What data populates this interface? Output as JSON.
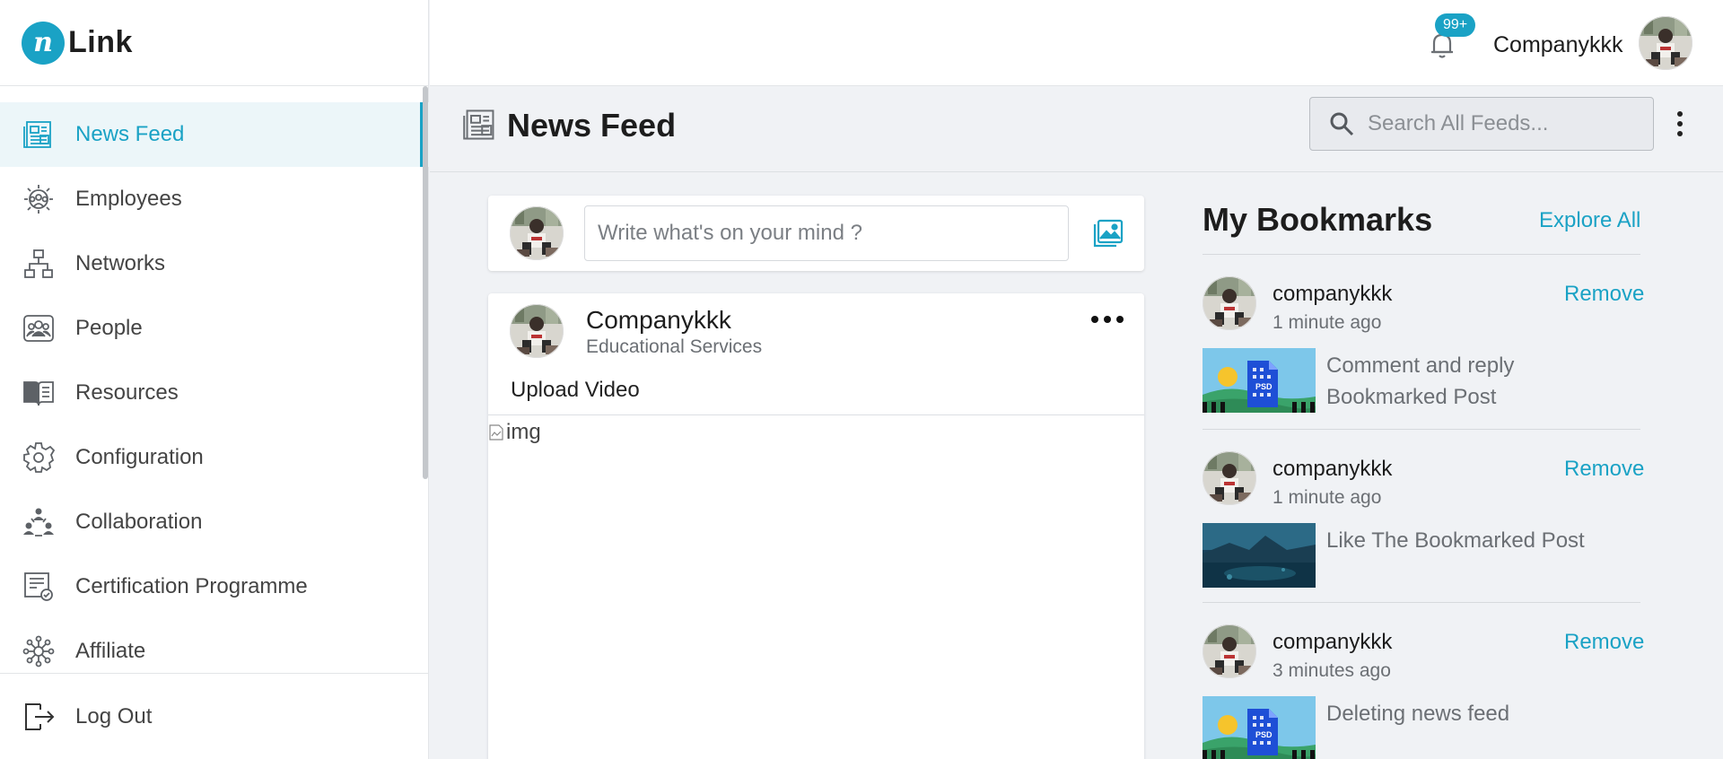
{
  "brand": {
    "logo_letter": "n",
    "logo_text": "Link",
    "accent": "#1aa2c5"
  },
  "sidebar": {
    "items": [
      {
        "label": "News Feed",
        "icon": "news-icon",
        "active": true
      },
      {
        "label": "Employees",
        "icon": "employees-icon"
      },
      {
        "label": "Networks",
        "icon": "network-icon"
      },
      {
        "label": "People",
        "icon": "people-icon"
      },
      {
        "label": "Resources",
        "icon": "book-icon"
      },
      {
        "label": "Configuration",
        "icon": "gear-icon"
      },
      {
        "label": "Collaboration",
        "icon": "collaboration-icon"
      },
      {
        "label": "Certification Programme",
        "icon": "certificate-icon"
      },
      {
        "label": "Affiliate",
        "icon": "affiliate-icon"
      }
    ],
    "logout_label": "Log Out"
  },
  "topbar": {
    "notification_count": "99+",
    "user_name": "Companykkk"
  },
  "page": {
    "title": "News Feed",
    "search_placeholder": "Search All Feeds..."
  },
  "composer": {
    "placeholder": "Write what's on your mind ?"
  },
  "post": {
    "author": "Companykkk",
    "subtitle": "Educational Services",
    "text": "Upload Video",
    "image_alt": "img"
  },
  "bookmarks": {
    "title": "My Bookmarks",
    "explore_label": "Explore All",
    "remove_label": "Remove",
    "items": [
      {
        "name": "companykkk",
        "time": "1 minute ago",
        "text": "Comment and reply Bookmarked Post",
        "thumb": "psd-placeholder"
      },
      {
        "name": "companykkk",
        "time": "1 minute ago",
        "text": "Like The Bookmarked Post",
        "thumb": "landscape-photo"
      },
      {
        "name": "companykkk",
        "time": "3 minutes ago",
        "text": "Deleting news feed",
        "thumb": "psd-placeholder"
      }
    ]
  }
}
